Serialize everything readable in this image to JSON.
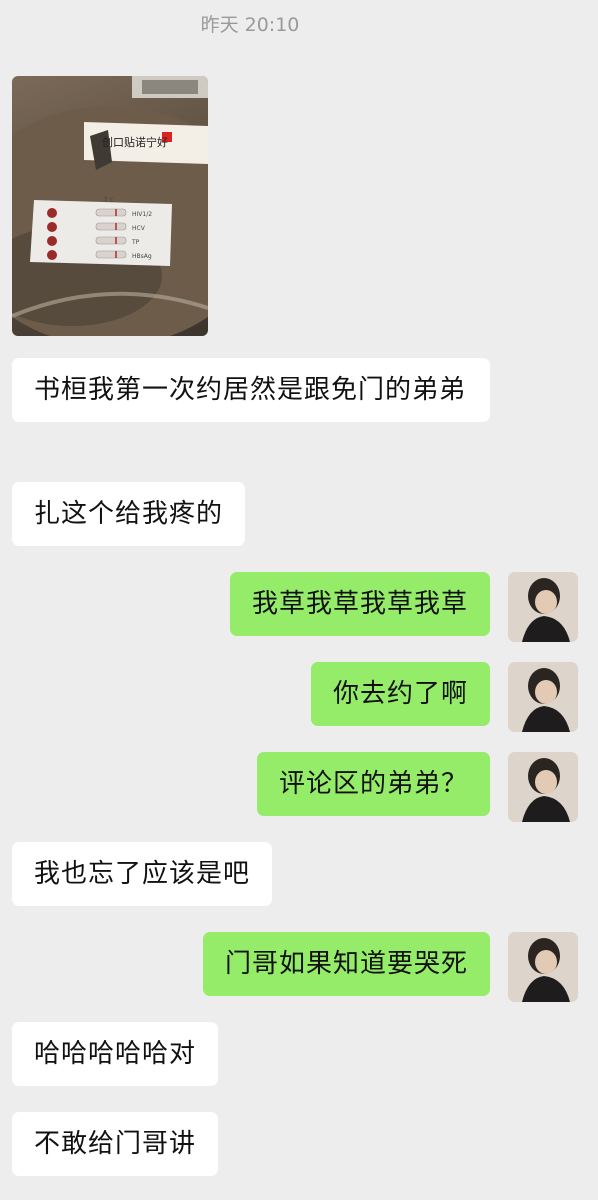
{
  "timestamp": "昨天 20:10",
  "photo": {
    "description_icon": "test-kit-photo",
    "packet_text": "创口贴诺宁好",
    "kit_labels": [
      "HIV1/2",
      "HCV",
      "TP",
      "HBsAg"
    ],
    "kit_bottom": "T  C"
  },
  "messages": [
    {
      "side": "in",
      "text": "书桓我第一次约居然是跟免门的弟弟"
    },
    {
      "side": "in",
      "text": "扎这个给我疼的"
    },
    {
      "side": "out",
      "text": "我草我草我草我草"
    },
    {
      "side": "out",
      "text": "你去约了啊"
    },
    {
      "side": "out",
      "text": "评论区的弟弟？"
    },
    {
      "side": "in",
      "text": "我也忘了应该是吧"
    },
    {
      "side": "out",
      "text": "门哥如果知道要哭死"
    },
    {
      "side": "in",
      "text": "哈哈哈哈哈对"
    },
    {
      "side": "in",
      "text": "不敢给门哥讲"
    }
  ],
  "colors": {
    "background": "#ededed",
    "incoming_bubble": "#ffffff",
    "outgoing_bubble": "#95ec69",
    "timestamp": "#9a9a9a"
  }
}
